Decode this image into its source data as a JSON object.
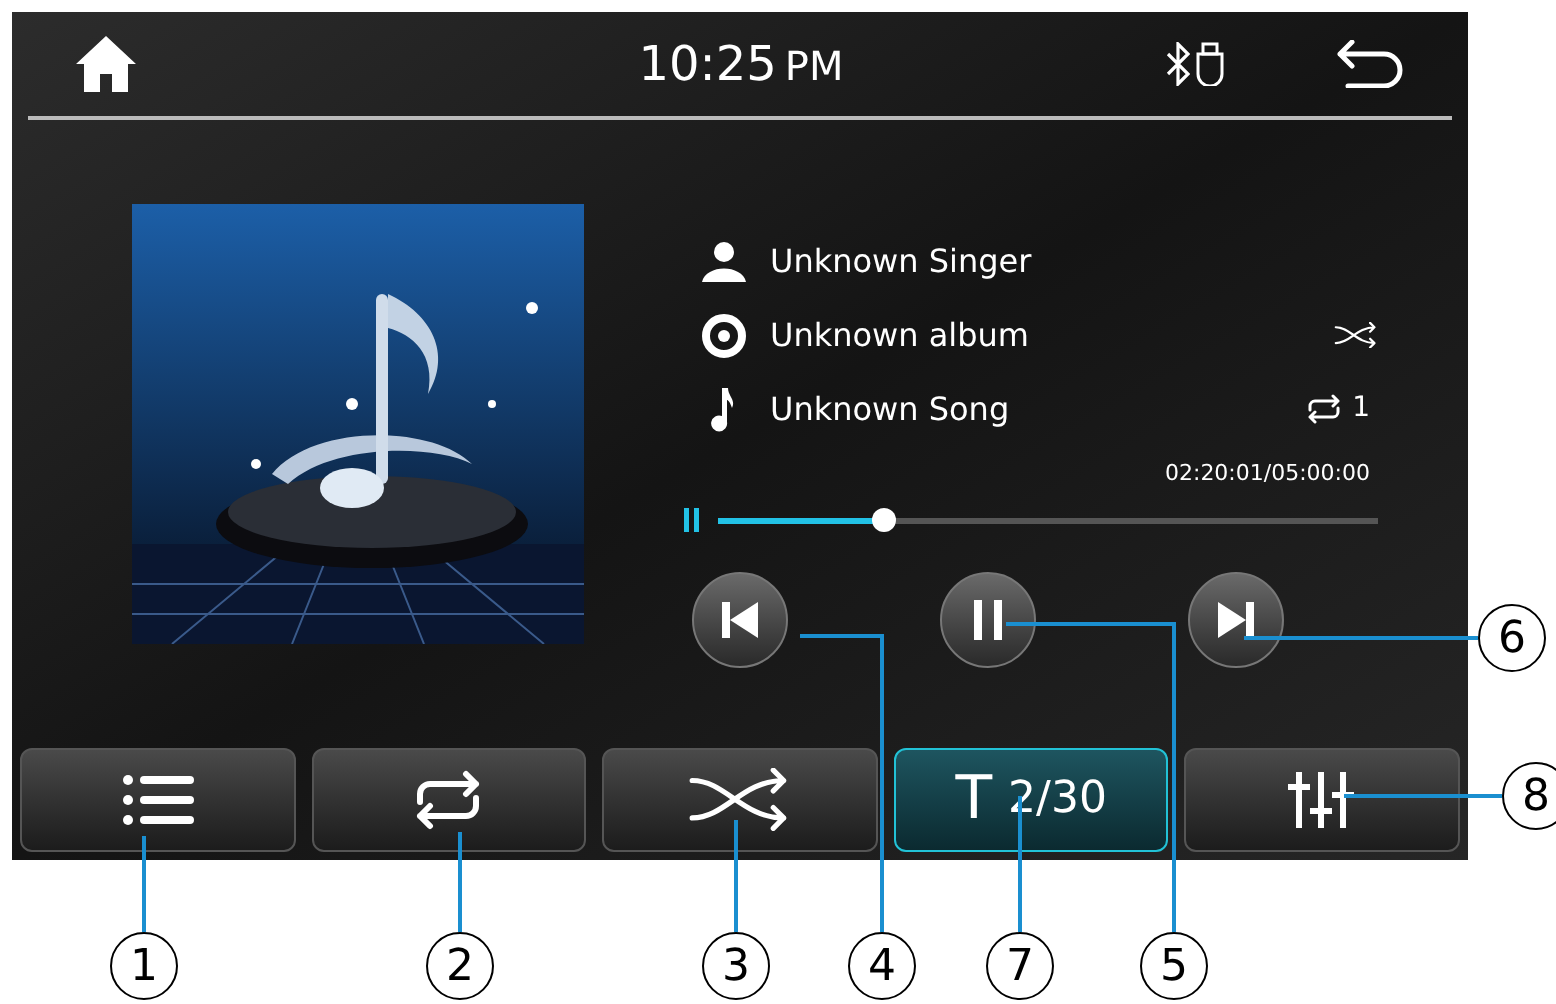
{
  "status_bar": {
    "time": "10:25",
    "period": "PM"
  },
  "track": {
    "fields": [
      {
        "kind": "singer",
        "text": "Unknown Singer"
      },
      {
        "kind": "album",
        "text": "Unknown album"
      },
      {
        "kind": "song",
        "text": "Unknown Song"
      }
    ],
    "repeat_count": "1",
    "time": "02:20:01/05:00:00",
    "level": 0.25,
    "playing": true
  },
  "bottom_buttons": [
    {
      "kind": "list",
      "selected": false
    },
    {
      "kind": "repeat",
      "selected": false
    },
    {
      "kind": "shuffle",
      "selected": false
    },
    {
      "kind": "track",
      "label": "T",
      "count": "2/30",
      "selected": true
    },
    {
      "kind": "equalizer",
      "selected": false
    }
  ],
  "callouts": [
    "1",
    "2",
    "3",
    "4",
    "7",
    "5",
    "6",
    "8"
  ]
}
